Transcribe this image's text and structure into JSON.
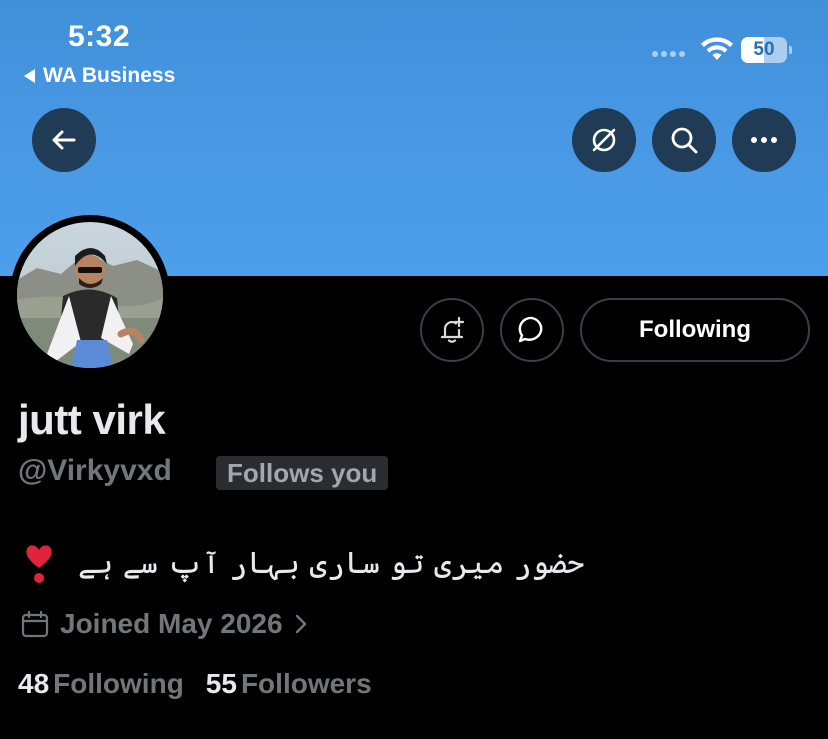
{
  "status_bar": {
    "time": "5:32",
    "back_app": "WA Business",
    "battery_percent": "50",
    "battery_level": 0.5
  },
  "nav": {
    "back_icon": "arrow-left-icon",
    "actions": [
      "no-notifications-icon",
      "search-icon",
      "more-icon"
    ]
  },
  "colors": {
    "banner": "#4a9ae6",
    "background": "#000000",
    "secondary_text": "#71767b",
    "heart": "#e0243c"
  },
  "profile": {
    "display_name": "jutt virk",
    "handle": "@Virkyvxd",
    "follows_you_label": "Follows you",
    "bio": "حضور میری تو ساری بہار آپ سے ہے",
    "bio_emoji": "heart-emoji",
    "joined": "Joined May 2026",
    "following_count": "48",
    "following_label": "Following",
    "followers_count": "55",
    "followers_label": "Followers"
  },
  "actions": {
    "notify_icon": "bell-plus-icon",
    "message_icon": "message-bubble-icon",
    "following_button": "Following"
  }
}
